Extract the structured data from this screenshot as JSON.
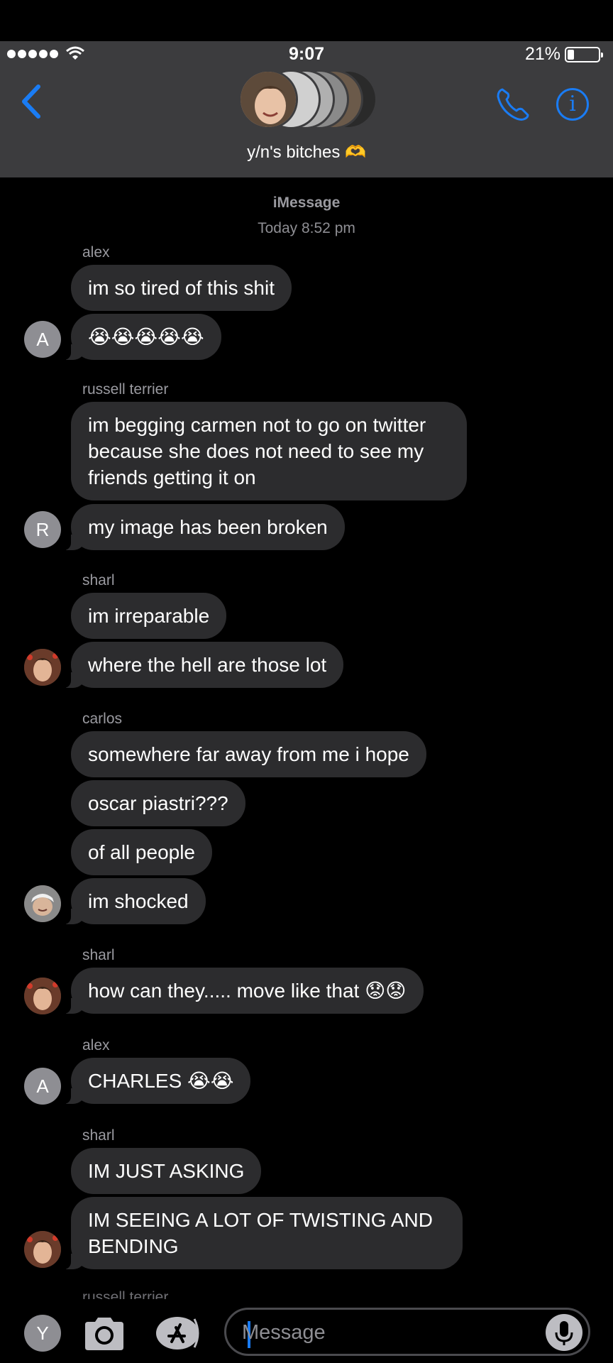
{
  "status_bar": {
    "time": "9:07",
    "battery_percent": "21%",
    "battery_level": 0.21
  },
  "header": {
    "group_name": "y/n's bitches",
    "group_emoji": "🫶"
  },
  "thread": {
    "service": "iMessage",
    "timestamp": "Today 8:52 pm",
    "groups": [
      {
        "sender": "alex",
        "avatar_letter": "A",
        "messages": [
          "im so tired of this shit",
          "😭😭😭😭😭"
        ]
      },
      {
        "sender": "russell terrier",
        "avatar_letter": "R",
        "messages": [
          "im begging carmen not to go on twitter because she does not need to see my friends getting it on",
          "my image has been broken"
        ]
      },
      {
        "sender": "sharl",
        "messages": [
          "im irreparable",
          "where the hell are those lot"
        ]
      },
      {
        "sender": "carlos",
        "messages": [
          "somewhere far away from me i hope",
          "oscar piastri???",
          "of all people",
          "im shocked"
        ]
      },
      {
        "sender": "sharl",
        "messages": [
          "how can they..... move like that 😟😟"
        ]
      },
      {
        "sender": "alex",
        "avatar_letter": "A",
        "messages": [
          "CHARLES 😭😭"
        ]
      },
      {
        "sender": "sharl",
        "messages": [
          "IM JUST ASKING",
          "IM SEEING A LOT OF TWISTING AND BENDING"
        ]
      }
    ],
    "next_sender": "russell terrier"
  },
  "composer": {
    "my_avatar_letter": "Y",
    "placeholder": "Message"
  },
  "colors": {
    "accent": "#1a7cf4",
    "header_bg": "#3c3c3e",
    "bubble_bg": "#2c2c2e",
    "meta_text": "#8e8e93"
  },
  "icons": [
    "back-chevron-icon",
    "phone-icon",
    "info-icon",
    "camera-icon",
    "app-store-icon",
    "microphone-icon"
  ]
}
